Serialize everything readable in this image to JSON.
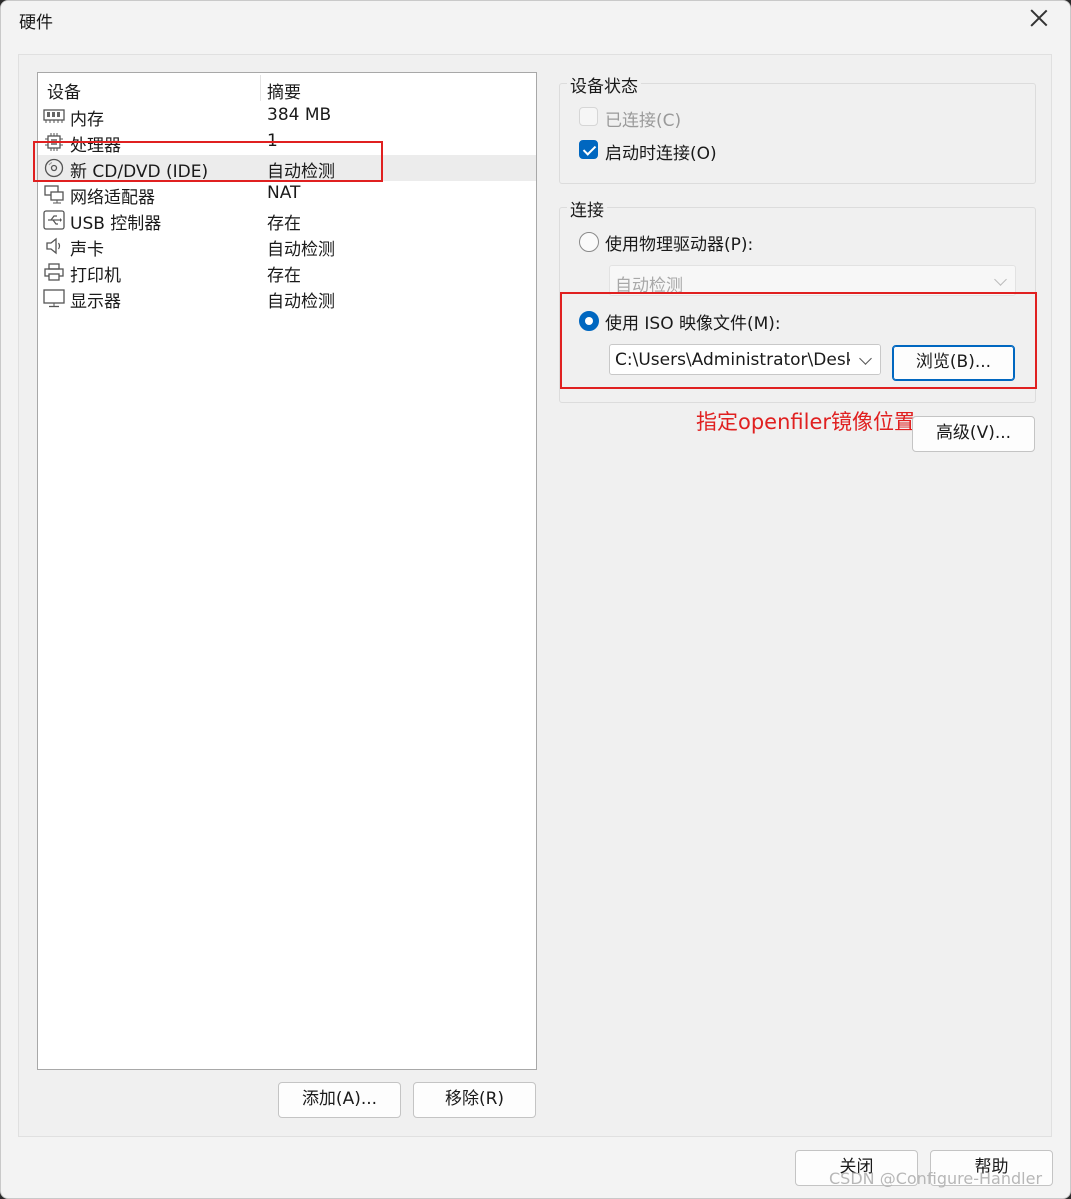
{
  "window": {
    "title": "硬件"
  },
  "device_list": {
    "headers": {
      "device": "设备",
      "summary": "摘要"
    },
    "items": [
      {
        "icon": "memory-icon",
        "name": "内存",
        "summary": "384 MB"
      },
      {
        "icon": "processor-icon",
        "name": "处理器",
        "summary": "1"
      },
      {
        "icon": "cd-dvd-icon",
        "name": "新 CD/DVD (IDE)",
        "summary": "自动检测",
        "selected": true
      },
      {
        "icon": "network-adapter-icon",
        "name": "网络适配器",
        "summary": "NAT"
      },
      {
        "icon": "usb-icon",
        "name": "USB 控制器",
        "summary": "存在"
      },
      {
        "icon": "sound-card-icon",
        "name": "声卡",
        "summary": "自动检测"
      },
      {
        "icon": "printer-icon",
        "name": "打印机",
        "summary": "存在"
      },
      {
        "icon": "display-icon",
        "name": "显示器",
        "summary": "自动检测"
      }
    ]
  },
  "list_buttons": {
    "add": "添加(A)...",
    "remove": "移除(R)"
  },
  "device_status": {
    "title": "设备状态",
    "connected": {
      "label": "已连接(C)",
      "checked": false,
      "disabled": true
    },
    "connect_at_power_on": {
      "label": "启动时连接(O)",
      "checked": true
    }
  },
  "connection": {
    "title": "连接",
    "physical": {
      "label": "使用物理驱动器(P):",
      "selected": false,
      "value": "自动检测"
    },
    "iso": {
      "label": "使用 ISO 映像文件(M):",
      "selected": true,
      "value": "C:\\Users\\Administrator\\Desktop\\openfiler",
      "browse": "浏览(B)..."
    }
  },
  "advanced_button": "高级(V)...",
  "annotation": "指定openfiler镜像位置",
  "footer": {
    "close": "关闭",
    "help": "帮助"
  },
  "watermark": "CSDN @Configure-Handler",
  "colors": {
    "accent": "#0067c0",
    "annotation_red": "#e02020"
  }
}
